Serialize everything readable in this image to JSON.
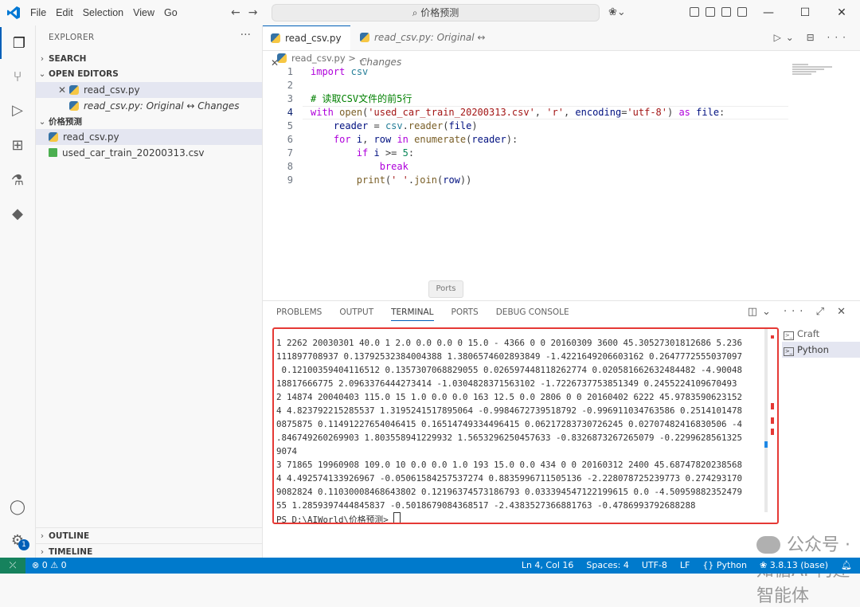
{
  "menu": [
    "File",
    "Edit",
    "Selection",
    "View",
    "Go"
  ],
  "search": "价格预测",
  "explorer": {
    "title": "EXPLORER",
    "search_section": "SEARCH",
    "open_editors": "OPEN EDITORS",
    "open_files": [
      "read_csv.py",
      "read_csv.py: Original ↔ Changes"
    ],
    "folder": "价格预测",
    "files": [
      "read_csv.py",
      "used_car_train_20200313.csv"
    ],
    "outline": "OUTLINE",
    "timeline": "TIMELINE"
  },
  "tabs": [
    "read_csv.py",
    "read_csv.py: Original ↔ Changes"
  ],
  "breadcrumb": "read_csv.py > ...",
  "code": {
    "line_numbers": [
      "1",
      "2",
      "3",
      "4",
      "5",
      "6",
      "7",
      "8",
      "9"
    ]
  },
  "ports_hint": "Ports",
  "panel_tabs": [
    "PROBLEMS",
    "OUTPUT",
    "TERMINAL",
    "PORTS",
    "DEBUG CONSOLE"
  ],
  "terminal_lines": [
    "1 2262 20030301 40.0 1 2.0 0.0 0.0 0 15.0 - 4366 0 0 20160309 3600 45.30527301812686 5.236",
    "111897708937 0.13792532384004388 1.3806574602893849 -1.4221649206603162 0.2647772555037097",
    " 0.12100359404116512 0.1357307068829055 0.026597448118262774 0.020581662632484482 -4.90048",
    "18817666775 2.0963376444273414 -1.0304828371563102 -1.7226737753851349 0.2455224109670493",
    "2 14874 20040403 115.0 15 1.0 0.0 0.0 163 12.5 0.0 2806 0 0 20160402 6222 45.9783590623152",
    "4 4.823792215285537 1.3195241517895064 -0.9984672739518792 -0.996911034763586 0.2514101478",
    "0875875 0.11491227654046415 0.16514749334496415 0.06217283730726245 0.02707482416830506 -4",
    ".846749260269903 1.803558941229932 1.5653296250457633 -0.8326873267265079 -0.2299628561325",
    "9074",
    "3 71865 19960908 109.0 10 0.0 0.0 1.0 193 15.0 0.0 434 0 0 20160312 2400 45.68747820238568",
    "4 4.492574133926967 -0.05061584257537274 0.8835996711505136 -2.228078725239773 0.274293170",
    "9082824 0.11030008468643802 0.12196374573186793 0.033394547122199615 0.0 -4.50959882352479",
    "55 1.2859397444845837 -0.5018679084368517 -2.4383527366881763 -0.4786993792688288"
  ],
  "prompt": "PS D:\\AIWorld\\价格预测> ",
  "terminal_list": [
    "Craft",
    "Python"
  ],
  "watermark": "公众号 · 知循AI-构建智能体",
  "status": {
    "errors": "⊗ 0 ⚠ 0",
    "position": "Ln 4, Col 16",
    "spaces": "Spaces: 4",
    "encoding": "UTF-8",
    "eol": "LF",
    "language": "{} Python",
    "interpreter": "3.8.13 (base)"
  },
  "colors": {
    "accent": "#007acc",
    "highlight_border": "#e53935"
  }
}
